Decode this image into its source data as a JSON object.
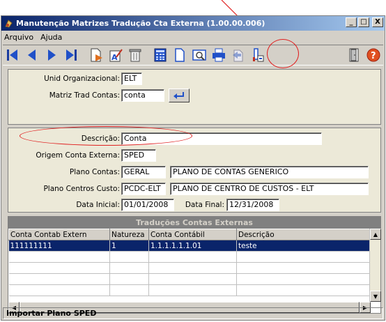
{
  "window": {
    "title": "Manutenção Matrizes Tradução Cta Externa (1.00.00.006)",
    "controls": {
      "minimize": "_",
      "maximize": "□",
      "close": "X"
    }
  },
  "menu": [
    {
      "label": "Arquivo"
    },
    {
      "label": "Ajuda"
    }
  ],
  "toolbar": {
    "buttons": [
      "first-record-icon",
      "prev-record-icon",
      "next-record-icon",
      "last-record-icon",
      "new-record-icon",
      "edit-record-icon",
      "delete-record-icon",
      "calculator-icon",
      "blank-page-icon",
      "preview-icon",
      "print-icon",
      "import-icon",
      "import-sped-icon",
      "exit-door-icon",
      "help-icon"
    ]
  },
  "form1": {
    "unid_label": "Unid Organizacional:",
    "unid_value": "ELT",
    "matriz_label": "Matriz Trad Contas:",
    "matriz_value": "conta"
  },
  "form2": {
    "descricao_label": "Descrição:",
    "descricao_value": "Conta",
    "origem_label": "Origem Conta Externa:",
    "origem_value": "SPED",
    "plano_contas_label": "Plano Contas:",
    "plano_contas_code": "GERAL",
    "plano_contas_desc": "PLANO DE CONTAS GENERICO",
    "plano_cc_label": "Plano Centros Custo:",
    "plano_cc_code": "PCDC-ELT",
    "plano_cc_desc": "PLANO DE CENTRO DE CUSTOS - ELT",
    "data_inicial_label": "Data Inicial:",
    "data_inicial_value": "01/01/2008",
    "data_final_label": "Data Final:",
    "data_final_value": "12/31/2008"
  },
  "grid": {
    "title": "Traduções Contas Externas",
    "columns": [
      "Conta Contab Extern",
      "Natureza",
      "Conta Contábil",
      "Descrição"
    ],
    "rows": [
      [
        "111111111",
        "1",
        "1.1.1.1.1.1.01",
        "teste"
      ]
    ]
  },
  "status": "Importar Plano SPED",
  "colors": {
    "titlebar_start": "#0a246a",
    "titlebar_end": "#a6caf0",
    "annotation": "#e02020",
    "selection": "#0a246a"
  }
}
